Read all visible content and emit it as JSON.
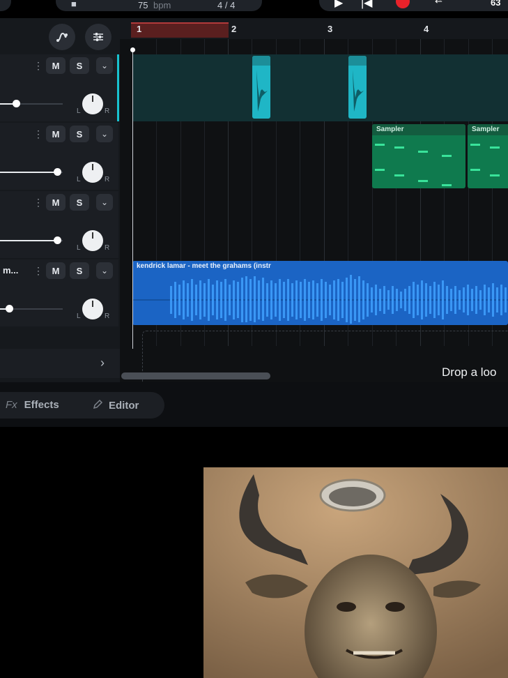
{
  "transport": {
    "tempo_value": "75",
    "tempo_unit": "bpm",
    "time_signature": "4 / 4",
    "cropped_right_text": "63"
  },
  "ruler": {
    "bars": [
      "1",
      "2",
      "3",
      "4"
    ]
  },
  "tracks": [
    {
      "mute_label": "M",
      "solo_label": "S",
      "menu_label": "⋮",
      "pan_left": "L",
      "pan_right": "R",
      "name": "",
      "volume_level": 0.25
    },
    {
      "mute_label": "M",
      "solo_label": "S",
      "menu_label": "⋮",
      "pan_left": "L",
      "pan_right": "R",
      "name": "",
      "volume_level": 0.5
    },
    {
      "mute_label": "M",
      "solo_label": "S",
      "menu_label": "⋮",
      "pan_left": "L",
      "pan_right": "R",
      "name": "",
      "volume_level": 0.5
    },
    {
      "mute_label": "M",
      "solo_label": "S",
      "menu_label": "⋮",
      "pan_left": "L",
      "pan_right": "R",
      "name": "m...",
      "volume_level": 0.1
    }
  ],
  "clips": {
    "sampler_1": "Sampler",
    "sampler_2": "Sampler",
    "audio_name": "kendrick lamar - meet the grahams (instr"
  },
  "drop_zone_text": "Drop a loo",
  "bottom_tabs": {
    "effects_icon": "Fx",
    "effects_label": "Effects",
    "editor_label": "Editor"
  },
  "icons": {
    "automation": "automation-curve-icon",
    "mixer": "mixer-sliders-icon",
    "play": "play-icon",
    "return": "return-to-start-icon",
    "record": "record-icon",
    "chevron": "chevron-down-icon",
    "add_track": "chevron-right-icon",
    "edit": "pencil-icon"
  },
  "colors": {
    "teal_clip": "#1fb6c6",
    "sampler_clip": "#0f7a4e",
    "audio_clip": "#1b64c4",
    "record": "#e8222a",
    "loop_region": "#5a1f1f"
  }
}
